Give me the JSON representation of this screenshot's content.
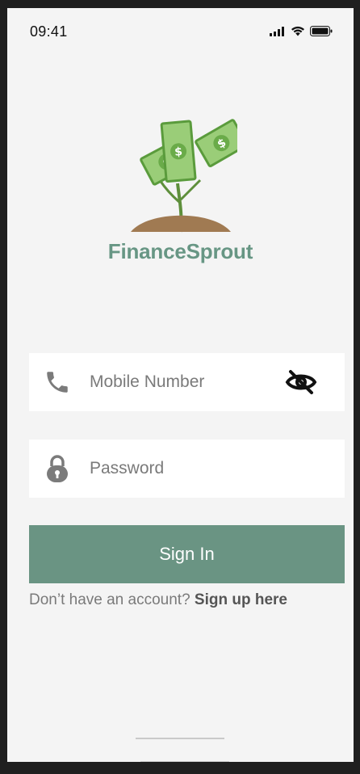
{
  "status_bar": {
    "time": "09:41",
    "icons": [
      "signal-icon",
      "wifi-icon",
      "battery-icon"
    ]
  },
  "brand": {
    "name": "FinanceSprout",
    "color": "#679684",
    "logo_icon": "money-sprout-logo"
  },
  "form": {
    "mobile": {
      "placeholder": "Mobile Number",
      "lead_icon": "phone-icon",
      "trail_icon": "eye-off-icon"
    },
    "password": {
      "placeholder": "Password",
      "lead_icon": "lock-icon"
    },
    "submit_label": "Sign In",
    "submit_color": "#6a9483"
  },
  "signup": {
    "prompt": "Don’t have an account?",
    "link": "Sign up here"
  }
}
